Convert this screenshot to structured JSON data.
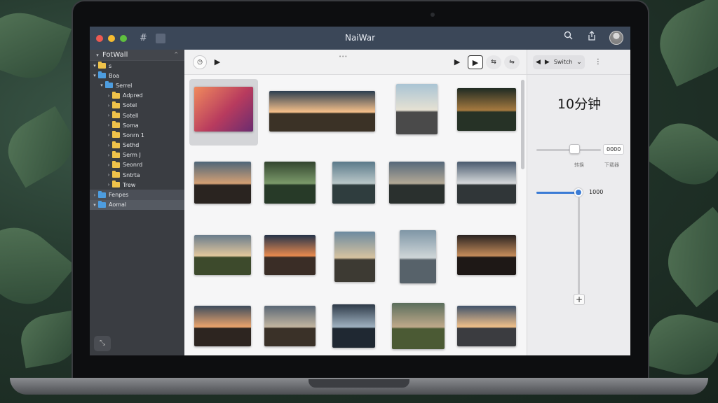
{
  "window": {
    "title": "NaiWar"
  },
  "titlebar": {
    "hash_icon": "#"
  },
  "sidebar": {
    "header": "FotWall",
    "rows": [
      {
        "label": "s",
        "level": 0,
        "arrow": "▾",
        "color": "yellow"
      },
      {
        "label": "Boa",
        "level": 0,
        "arrow": "▾",
        "color": "blue"
      },
      {
        "label": "Serrel",
        "level": 1,
        "arrow": "▾",
        "color": "blue"
      },
      {
        "label": "Adpred",
        "level": 2,
        "arrow": "›",
        "color": "yellow"
      },
      {
        "label": "Sotel",
        "level": 2,
        "arrow": "›",
        "color": "yellow"
      },
      {
        "label": "Sotell",
        "level": 2,
        "arrow": "›",
        "color": "yellow"
      },
      {
        "label": "Soma",
        "level": 2,
        "arrow": "›",
        "color": "yellow"
      },
      {
        "label": "Sonrn 1",
        "level": 2,
        "arrow": "›",
        "color": "yellow"
      },
      {
        "label": "Sethd",
        "level": 2,
        "arrow": "›",
        "color": "yellow"
      },
      {
        "label": "Serm J",
        "level": 2,
        "arrow": "›",
        "color": "yellow"
      },
      {
        "label": "Seonrd",
        "level": 2,
        "arrow": "›",
        "color": "yellow"
      },
      {
        "label": "Sntrta",
        "level": 2,
        "arrow": "›",
        "color": "yellow"
      },
      {
        "label": "Trew",
        "level": 2,
        "arrow": "›",
        "color": "yellow"
      },
      {
        "label": "Fenpes",
        "level": 0,
        "arrow": "›",
        "color": "blue",
        "hl": true
      },
      {
        "label": "Aomal",
        "level": 0,
        "arrow": "▾",
        "color": "blue",
        "sel": true
      }
    ],
    "bottom_icon": "⤡"
  },
  "toolbar": {
    "center_text": "•••"
  },
  "panel": {
    "switch_label": "Switch",
    "timer": "10分钟",
    "value1": "0000",
    "label_a": "转换",
    "label_b": "下载器",
    "value2": "1000",
    "slider1_level": 0.6,
    "slider2_level": 0.56
  },
  "colors": {
    "accent": "#3a7bd5",
    "titlebar": "#3b4758",
    "sidebar": "#3a3d42"
  },
  "thumbnails": [
    {
      "name": "gradient-wallpaper",
      "sky": [
        "#f08a5d",
        "#b83b5e"
      ],
      "land": "#6a2c70"
    },
    {
      "name": "plain-sunrise",
      "sky": [
        "#2c3e50",
        "#f6c08a"
      ],
      "land": "#3b3226"
    },
    {
      "name": "road-cliff",
      "sky": [
        "#a9c4d4",
        "#e6e1d3"
      ],
      "land": "#4a4a4a"
    },
    {
      "name": "forest-sunset",
      "sky": [
        "#1f2b23",
        "#a67a3f"
      ],
      "land": "#263226"
    },
    {
      "name": "mountain-dusk",
      "sky": [
        "#4e6679",
        "#d4a074"
      ],
      "land": "#2a2420"
    },
    {
      "name": "forest-river",
      "sky": [
        "#33452f",
        "#7b9a6a"
      ],
      "land": "#273a28"
    },
    {
      "name": "lake-rock",
      "sky": [
        "#5b7a8a",
        "#b9c7c8"
      ],
      "land": "#2f3d3e"
    },
    {
      "name": "coast-cliffs",
      "sky": [
        "#56687a",
        "#b3a996"
      ],
      "land": "#2a302e"
    },
    {
      "name": "highway-light",
      "sky": [
        "#495a6e",
        "#d6d9db"
      ],
      "land": "#303638"
    },
    {
      "name": "valley-clouds",
      "sky": [
        "#6a7d8c",
        "#e2c79d"
      ],
      "land": "#3d4a2c"
    },
    {
      "name": "pyramid-sunset",
      "sky": [
        "#26344a",
        "#e88a4e"
      ],
      "land": "#3a2d26"
    },
    {
      "name": "cliff-road",
      "sky": [
        "#6c8aa0",
        "#d7c3a0"
      ],
      "land": "#3d3a33"
    },
    {
      "name": "woman-portrait",
      "sky": [
        "#7f96a6",
        "#cfd6d8"
      ],
      "land": "#57626a"
    },
    {
      "name": "tunnel-figure",
      "sky": [
        "#2b2422",
        "#c48c5a"
      ],
      "land": "#1e1816"
    },
    {
      "name": "hill-sunset",
      "sky": [
        "#3d4c5c",
        "#eaa46c"
      ],
      "land": "#2d2520"
    },
    {
      "name": "path-mountains",
      "sky": [
        "#5a6775",
        "#c2b5a0"
      ],
      "land": "#3a3128"
    },
    {
      "name": "mountain-lake",
      "sky": [
        "#2e3a48",
        "#9fb1c0"
      ],
      "land": "#1f2832"
    },
    {
      "name": "green-valley",
      "sky": [
        "#5b6e5c",
        "#bfa98a"
      ],
      "land": "#4b5a34"
    },
    {
      "name": "sea-sunset",
      "sky": [
        "#41536a",
        "#f0c08a"
      ],
      "land": "#3b3c40"
    }
  ]
}
